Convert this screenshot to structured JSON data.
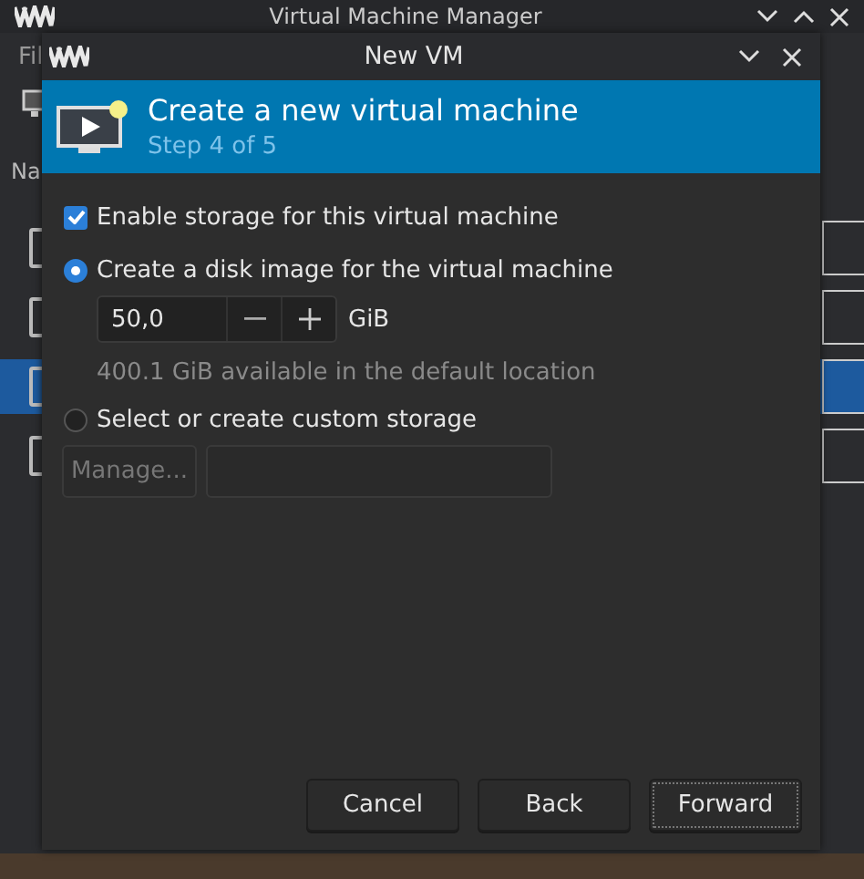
{
  "main_window": {
    "title": "Virtual Machine Manager",
    "menu_fragment": "Fil",
    "column_fragment": "Na"
  },
  "dialog": {
    "title": "New VM",
    "header": {
      "title": "Create a new virtual machine",
      "subtitle": "Step 4 of 5"
    },
    "enable_storage": {
      "label": "Enable storage for this virtual machine",
      "checked": true
    },
    "storage_options": [
      {
        "label": "Create a disk image for the virtual machine",
        "selected": true
      },
      {
        "label": "Select or create custom storage",
        "selected": false
      }
    ],
    "disk_size": {
      "value": "50,0",
      "unit": "GiB"
    },
    "available": "400.1 GiB available in the default location",
    "manage_button": {
      "label": "Manage...",
      "disabled": true
    },
    "buttons": [
      {
        "label": "Cancel",
        "focused": false
      },
      {
        "label": "Back",
        "focused": false
      },
      {
        "label": "Forward",
        "focused": true
      }
    ]
  }
}
